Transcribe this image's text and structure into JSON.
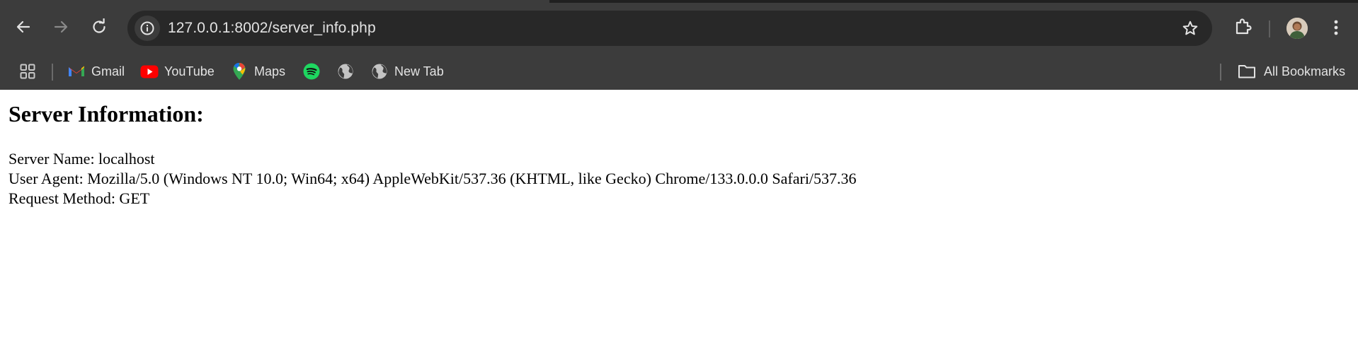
{
  "browser": {
    "url": "127.0.0.1:8002/server_info.php",
    "colors": {
      "chrome_bg": "#3c3c3c",
      "omnibox_bg": "#282828",
      "text": "#e3e3e3"
    },
    "bookmarks": [
      {
        "label": "Gmail",
        "icon": "gmail-icon"
      },
      {
        "label": "YouTube",
        "icon": "youtube-icon"
      },
      {
        "label": "Maps",
        "icon": "maps-icon"
      },
      {
        "label": "",
        "icon": "spotify-icon"
      },
      {
        "label": "",
        "icon": "globe-icon"
      },
      {
        "label": "New Tab",
        "icon": "globe-icon"
      }
    ],
    "all_bookmarks_label": "All Bookmarks"
  },
  "page": {
    "heading": "Server Information:",
    "lines": [
      "Server Name: localhost",
      "User Agent: Mozilla/5.0 (Windows NT 10.0; Win64; x64) AppleWebKit/537.36 (KHTML, like Gecko) Chrome/133.0.0.0 Safari/537.36",
      "Request Method: GET"
    ]
  }
}
